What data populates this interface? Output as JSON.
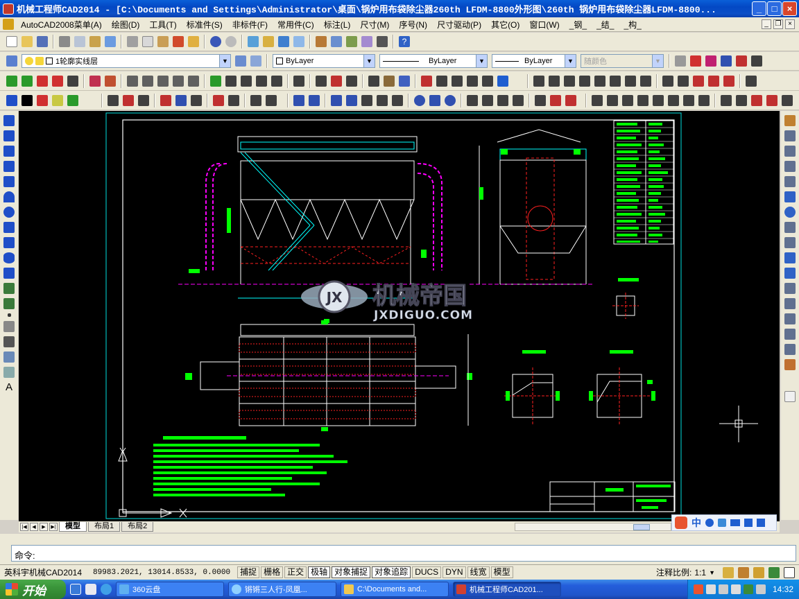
{
  "window": {
    "title": "机械工程师CAD2014 - [C:\\Documents and Settings\\Administrator\\桌面\\锅炉用布袋除尘器260th LFDM-8800外形图\\260th 锅炉用布袋除尘器LFDM-8800...",
    "controls": {
      "minimize": "_",
      "maximize": "□",
      "close": "×"
    }
  },
  "menu": {
    "items": [
      "AutoCAD2008菜单(A)",
      "绘图(D)",
      "工具(T)",
      "标准件(S)",
      "非标件(F)",
      "常用件(C)",
      "标注(L)",
      "尺寸(M)",
      "序号(N)",
      "尺寸驱动(P)",
      "其它(O)",
      "窗口(W)",
      "_钢_",
      "_结_",
      "_构_"
    ]
  },
  "properties_bar": {
    "layer": "1轮廓实线层",
    "color": "ByLayer",
    "linetype": "ByLayer",
    "lineweight": "ByLayer",
    "plotstyle": "随颜色"
  },
  "drawing": {
    "watermark_title": "机械帝国",
    "watermark_sub": "JXDIGUO.COM",
    "watermark_logo": "JX"
  },
  "layout_tabs": [
    "模型",
    "布局1",
    "布局2"
  ],
  "command": {
    "prompt": "命令:"
  },
  "status": {
    "app_name": "英科宇机械CAD2014",
    "coordinates": "89983.2021, 13014.8533, 0.0000",
    "toggles": [
      {
        "label": "捕捉",
        "on": false
      },
      {
        "label": "栅格",
        "on": false
      },
      {
        "label": "正交",
        "on": false
      },
      {
        "label": "极轴",
        "on": true
      },
      {
        "label": "对象捕捉",
        "on": true
      },
      {
        "label": "对象追踪",
        "on": true
      },
      {
        "label": "DUCS",
        "on": false
      },
      {
        "label": "DYN",
        "on": false
      },
      {
        "label": "线宽",
        "on": false
      },
      {
        "label": "模型",
        "on": false
      }
    ],
    "annotation_scale_label": "注释比例:",
    "annotation_scale": "1:1"
  },
  "taskbar": {
    "start": "开始",
    "tasks": [
      {
        "label": "360云盘",
        "active": false
      },
      {
        "label": "锵锵三人行-凤凰...",
        "active": false
      },
      {
        "label": "C:\\Documents and...",
        "active": false
      },
      {
        "label": "机械工程师CAD201...",
        "active": true
      }
    ],
    "clock": "14:32"
  },
  "colors": {
    "accent_green": "#00ff00",
    "cad_cyan": "#00ffff",
    "cad_magenta": "#ff00ff",
    "cad_red": "#ff2020",
    "cad_white": "#ffffff"
  }
}
